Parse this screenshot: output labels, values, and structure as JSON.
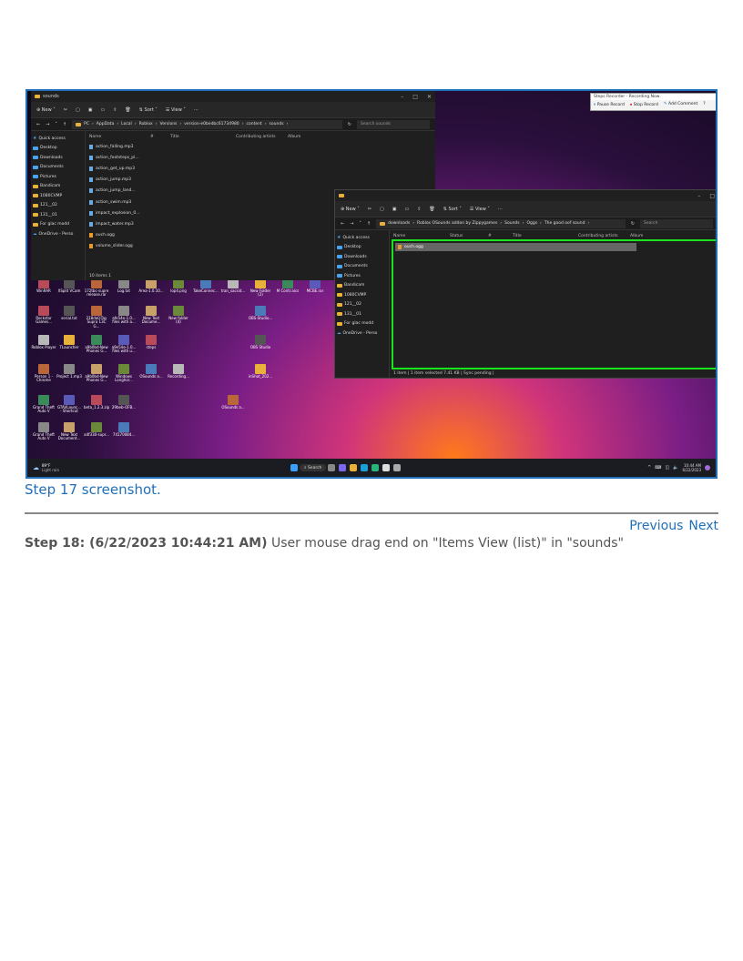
{
  "screenshot": {
    "win1": {
      "title": "sounds",
      "toolbar": [
        "New",
        "Sort",
        "View",
        "···"
      ],
      "breadcrumb": [
        "PC",
        "AppData",
        "Local",
        "Roblox",
        "Versions",
        "version-e0bedbc61734980",
        "content",
        "sounds"
      ],
      "search_placeholder": "Search sounds",
      "columns": [
        "Name",
        "#",
        "Title",
        "Contributing artists",
        "Album"
      ],
      "nav": [
        "Quick access",
        "Desktop",
        "Downloads",
        "Documents",
        "Pictures",
        "Bandicam",
        "1080CVMP",
        "121__02",
        "131__01",
        "For glac modd",
        "OneDrive - Perso"
      ],
      "files": [
        "action_falling.mp3",
        "action_footsteps_pl...",
        "action_get_up.mp3",
        "action_jump.mp3",
        "action_jump_land...",
        "action_swim.mp3",
        "impact_explosion_0...",
        "impact_water.mp3",
        "ouch.ogg",
        "volume_slider.ogg"
      ],
      "status": "10 items  1"
    },
    "win2": {
      "toolbar": [
        "New",
        "Sort",
        "View",
        "···"
      ],
      "breadcrumb": [
        "downloads",
        "Roblox OSounds addon by Zippygames",
        "Sounds",
        "Oggs",
        "The good oof sound"
      ],
      "search_placeholder": "Search",
      "columns": [
        "Name",
        "Status",
        "#",
        "Title",
        "Contributing artists",
        "Album"
      ],
      "nav": [
        "Quick access",
        "Desktop",
        "Downloads",
        "Documents",
        "Pictures",
        "Bandicam",
        "1080CVMP",
        "121__02",
        "131__01",
        "For glac modd",
        "OneDrive - Perso"
      ],
      "file": "ouch.ogg",
      "status": "1 item  |  1 item selected  7.41 KB  |  Sync pending  |"
    },
    "recorder": {
      "title": "Steps Recorder - Recording Now",
      "buttons": [
        "Pause Record",
        "Stop Record",
        "Add Comment"
      ]
    },
    "desktop_icons": [
      "WinRAR",
      "XSplit VCam",
      "172tbc-supre release.rar",
      "Log.txt",
      "Area-1.0.10...",
      "lop4.png",
      "TakeConnec...",
      "tran_sacsid...",
      "New Folder (2)",
      "M Contr.aics",
      "MCBE.rar",
      "Rockstar Games...",
      "serial.txt",
      "218da0-Tay Supra 13C G...",
      "afe54e-1.0... files with a...",
      "New Text Docume...",
      "New folder (4)",
      "OBS-Studio...",
      "Roblox Player",
      "TLauncher",
      "a9b0bd-New Phones G...",
      "a9e54e-1.0... files with u...",
      "steps",
      "OBS Studio",
      "Person 1 - Chrome",
      "Project 1.mp3",
      "a9b0bd-New Phones G...",
      "Windows Longhor...",
      "OSounds a...",
      "Recording...",
      "inShot_202...",
      "Grand Theft Auto V",
      "GTAVLaunc... - Shortcut",
      "beta_1.2.3.zip",
      "29beb-OFB...",
      "OSounds a...",
      "Grand Theft Auto V",
      "New Text Document...",
      "a4f330-supr...",
      "74170084..."
    ],
    "taskbar": {
      "weather_temp": "89°F",
      "weather_desc": "Light rain",
      "search": "Search",
      "time": "10:44 AM",
      "date": "6/22/2023"
    }
  },
  "caption": "Step 17 screenshot.",
  "nav": {
    "previous": "Previous",
    "next": "Next"
  },
  "step": {
    "label": "Step 18: (6/22/2023 10:44:21 AM)",
    "text": " User mouse drag end on \"Items View (list)\" in \"sounds\""
  }
}
